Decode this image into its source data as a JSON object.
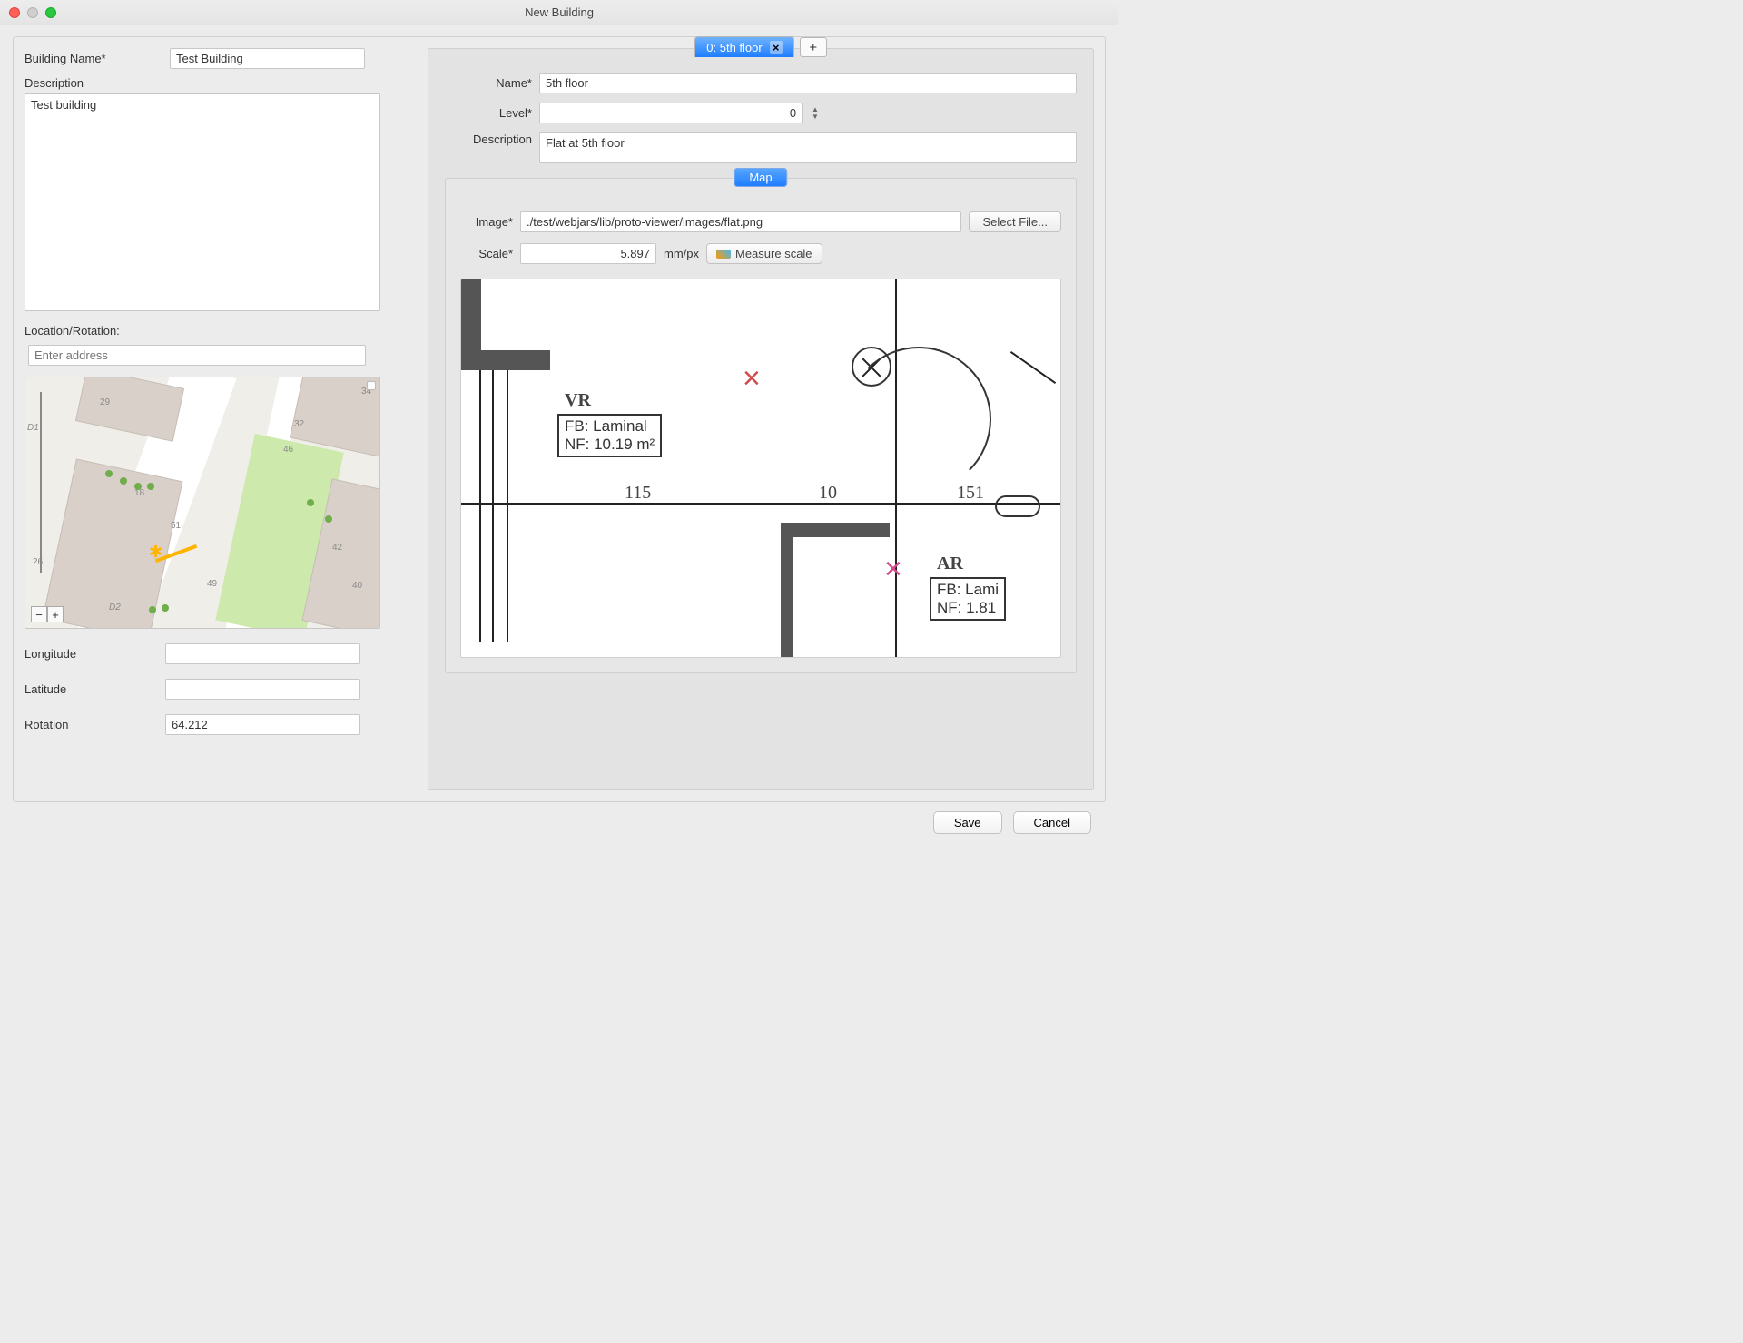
{
  "window": {
    "title": "New Building"
  },
  "building": {
    "name_label": "Building Name*",
    "name_value": "Test Building",
    "description_label": "Description",
    "description_value": "Test building"
  },
  "location": {
    "section_label": "Location/Rotation:",
    "address_placeholder": "Enter address",
    "longitude_label": "Longitude",
    "longitude_value": "",
    "latitude_label": "Latitude",
    "latitude_value": "",
    "rotation_label": "Rotation",
    "rotation_value": "64.212",
    "map_numbers": [
      "29",
      "34",
      "32",
      "46",
      "18",
      "51",
      "42",
      "26",
      "49",
      "40",
      "D1",
      "D2"
    ]
  },
  "floor_tab": {
    "label": "0: 5th floor",
    "add_label": "+"
  },
  "floor": {
    "name_label": "Name*",
    "name_value": "5th floor",
    "level_label": "Level*",
    "level_value": "0",
    "description_label": "Description",
    "description_value": "Flat at 5th floor"
  },
  "map_section": {
    "tab_label": "Map",
    "image_label": "Image*",
    "image_value": "./test/webjars/lib/proto-viewer/images/flat.png",
    "select_file_label": "Select File...",
    "scale_label": "Scale*",
    "scale_value": "5.897",
    "scale_unit": "mm/px",
    "measure_label": "Measure scale"
  },
  "floorplan": {
    "room1_label": "VR",
    "room1_line1": "FB: Laminal",
    "room1_line2": "NF: 10.19 m²",
    "dim1": "115",
    "dim2": "10",
    "dim3": "151",
    "room2_label": "AR",
    "room2_line1": "FB: Lami",
    "room2_line2": "NF:  1.81"
  },
  "buttons": {
    "save": "Save",
    "cancel": "Cancel"
  }
}
